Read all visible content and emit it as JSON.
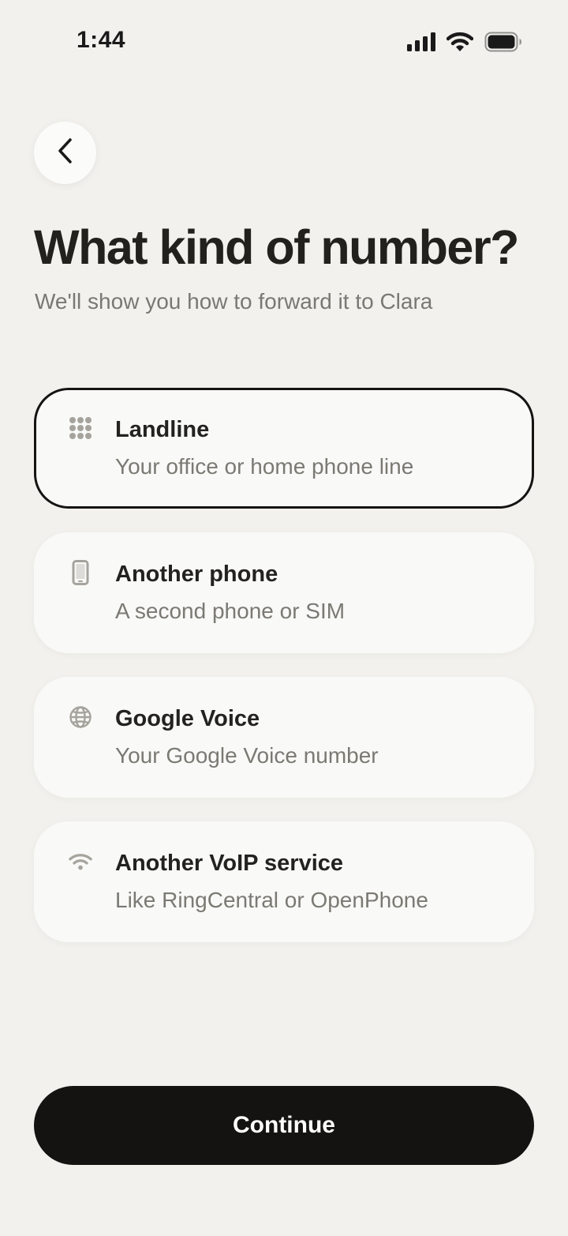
{
  "status_bar": {
    "time": "1:44",
    "icons": [
      "cellular-signal-icon",
      "wifi-icon",
      "battery-icon"
    ]
  },
  "header": {
    "back_icon": "chevron-left-icon",
    "title": "What kind of number?",
    "subtitle": "We'll show you how to forward it to Clara"
  },
  "options": [
    {
      "title": "Landline",
      "description": "Your office or home phone line",
      "icon": "keypad-icon",
      "selected": true
    },
    {
      "title": "Another phone",
      "description": "A second phone or SIM",
      "icon": "mobile-phone-icon",
      "selected": false
    },
    {
      "title": "Google Voice",
      "description": "Your Google Voice number",
      "icon": "globe-icon",
      "selected": false
    },
    {
      "title": "Another VoIP service",
      "description": "Like RingCentral or OpenPhone",
      "icon": "wifi-icon",
      "selected": false
    }
  ],
  "footer": {
    "continue_label": "Continue"
  },
  "colors": {
    "background": "#f2f1ed",
    "card": "#f9f9f7",
    "selected_border": "#151413",
    "primary_button": "#141312",
    "icon_gray": "#a5a39c"
  }
}
